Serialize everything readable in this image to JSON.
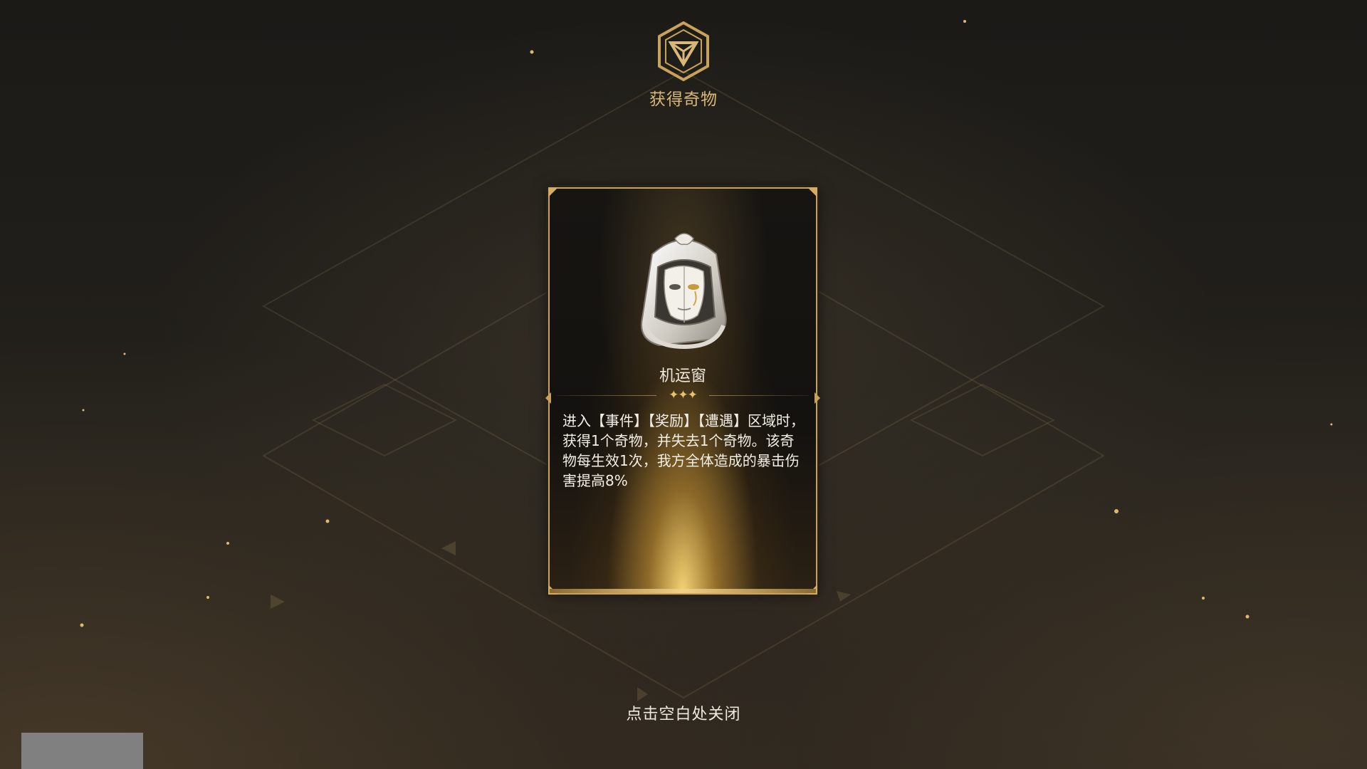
{
  "header": {
    "title": "获得奇物",
    "emblem_icon": "triangle-emblem-icon"
  },
  "card": {
    "item_name": "机运窗",
    "stars": "✦✦✦",
    "rarity_stars": 3,
    "description": "进入【事件】【奖励】【遭遇】区域时，获得1个奇物，并失去1个奇物。该奇物每生效1次，我方全体造成的暴击伤害提高8%",
    "item_icon": "mask-frame-icon"
  },
  "footer": {
    "close_hint": "点击空白处关闭"
  },
  "colors": {
    "accent_gold": "#d9b877",
    "border_gold": "#c9a25a",
    "text_light": "#f4efe6",
    "background": "#1f1c18"
  }
}
